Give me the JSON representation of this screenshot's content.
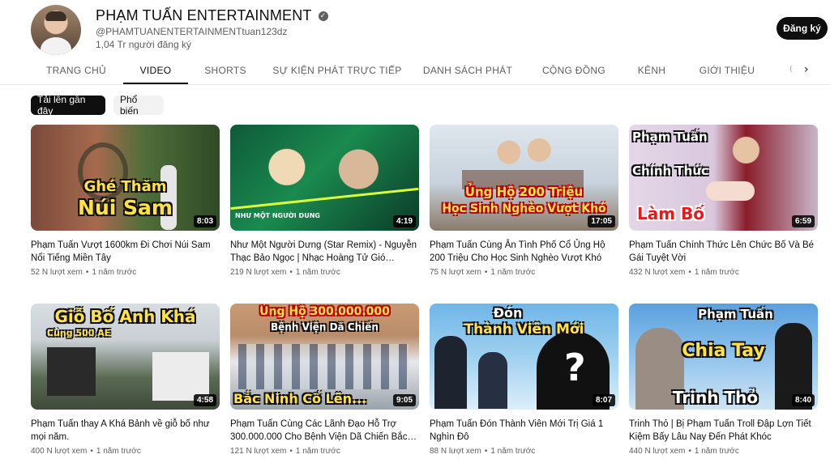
{
  "channel": {
    "name": "PHẠM TUẤN ENTERTAINMENT",
    "handle": "@PHAMTUANENTERTAINMENTtuan123dz",
    "subscribers": "1,04 Tr người đăng ký",
    "subscribe_label": "Đăng ký"
  },
  "tabs": [
    {
      "label": "TRANG CHỦ"
    },
    {
      "label": "VIDEO"
    },
    {
      "label": "SHORTS"
    },
    {
      "label": "SỰ KIỆN PHÁT TRỰC TIẾP"
    },
    {
      "label": "DANH SÁCH PHÁT"
    },
    {
      "label": "CỘNG ĐỒNG"
    },
    {
      "label": "KÊNH"
    },
    {
      "label": "GIỚI THIỆU"
    }
  ],
  "active_tab": "VIDEO",
  "chips": [
    {
      "label": "Tải lên gần đây"
    },
    {
      "label": "Phổ biến"
    }
  ],
  "meta_separator": "•",
  "videos": [
    {
      "thumb_text": [
        "Ghé Thăm",
        "Núi Sam"
      ],
      "duration": "8:03",
      "title": "Phạm Tuấn Vượt 1600km Đi Chơi Núi Sam Nổi Tiếng Miền Tây",
      "views": "52 N lượt xem",
      "age": "1 năm trước"
    },
    {
      "thumb_text": [
        "NHƯ MỘT NGƯỜI DUNG"
      ],
      "duration": "4:19",
      "title": "Như Một Người Dưng (Star Remix) - Nguyễn Thạc Bảo Ngọc | Nhạc Hoàng Tử Gió Remix…",
      "views": "219 N lượt xem",
      "age": "1 năm trước"
    },
    {
      "thumb_text": [
        "Ủng Hộ 200 Triệu",
        "Học Sinh Nghèo Vượt Khó"
      ],
      "duration": "17:05",
      "title": "Phạm Tuấn Cùng Ân Tình Phố Cổ Ủng Hộ 200 Triệu Cho Học Sinh Nghèo Vượt Khó",
      "views": "75 N lượt xem",
      "age": "1 năm trước"
    },
    {
      "thumb_text": [
        "Phạm Tuấn",
        "Chính Thức",
        "Làm Bố"
      ],
      "duration": "6:59",
      "title": "Phạm Tuấn Chính Thức Lên Chức Bố Và Bé Gái Tuyệt Vời",
      "views": "432 N lượt xem",
      "age": "1 năm trước"
    },
    {
      "thumb_text": [
        "Giỗ Bố Anh Khá",
        "Cùng 500 AE"
      ],
      "duration": "4:58",
      "title": "Phạm Tuấn thay A Khá Bảnh về giỗ bố như mọi năm.",
      "views": "400 N lượt xem",
      "age": "1 năm trước"
    },
    {
      "thumb_text": [
        "Ủng Hộ 300.000.000",
        "Bệnh Viện Dã Chiến",
        "Bắc Ninh Cố Lên..."
      ],
      "duration": "9:05",
      "title": "Phạm Tuấn Cùng Các Lãnh Đạo Hỗ Trợ 300.000.000 Cho Bệnh Viện Dã Chiến Bắc…",
      "views": "121 N lượt xem",
      "age": "1 năm trước"
    },
    {
      "thumb_text": [
        "Đón",
        "Thành Viên Mới"
      ],
      "duration": "8:07",
      "title": "Phạm Tuấn Đón Thành Viên Mới Trị Giá 1 Nghìn Đô",
      "views": "88 N lượt xem",
      "age": "1 năm trước"
    },
    {
      "thumb_text": [
        "Phạm Tuấn",
        "Chia Tay",
        "Trinh Thỏ"
      ],
      "duration": "8:40",
      "title": "Trinh Thỏ | Bị Phạm Tuấn Troll Đập Lợn Tiết Kiệm Bấy Lâu Nay Đến Phát Khóc",
      "views": "440 N lượt xem",
      "age": "1 năm trước"
    }
  ]
}
